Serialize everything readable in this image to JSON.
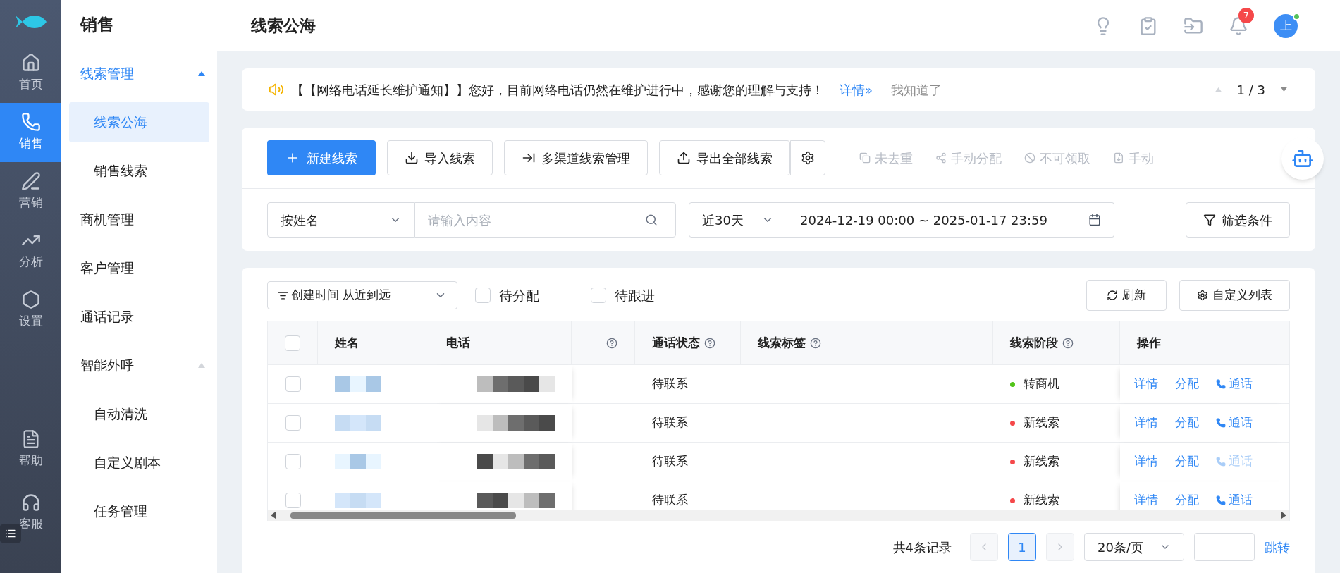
{
  "rail": {
    "items": [
      {
        "label": "首页",
        "selected": false
      },
      {
        "label": "销售",
        "selected": true
      },
      {
        "label": "营销",
        "selected": false
      },
      {
        "label": "分析",
        "selected": false
      },
      {
        "label": "设置",
        "selected": false
      }
    ],
    "bottom_items": [
      {
        "label": "帮助"
      },
      {
        "label": "客服"
      }
    ]
  },
  "sidebar": {
    "title": "销售",
    "items": [
      {
        "label": "线索管理",
        "expanded": true,
        "children": [
          {
            "label": "线索公海",
            "selected": true
          },
          {
            "label": "销售线索",
            "selected": false
          }
        ]
      },
      {
        "label": "商机管理"
      },
      {
        "label": "客户管理"
      },
      {
        "label": "通话记录"
      },
      {
        "label": "智能外呼",
        "expanded": true,
        "children": [
          {
            "label": "自动清洗",
            "selected": false
          },
          {
            "label": "自定义剧本",
            "selected": false
          },
          {
            "label": "任务管理",
            "selected": false
          }
        ]
      }
    ]
  },
  "header": {
    "title": "线索公海",
    "notifications": "7",
    "avatar": "上"
  },
  "notice": {
    "text": "【【网络电话延长维护通知】】您好，目前网络电话仍然在维护进行中，感谢您的理解与支持！",
    "link": "详情»",
    "dismiss": "我知道了",
    "pager": "1 / 3"
  },
  "toolbar": {
    "primary": "新建线索",
    "buttons": [
      {
        "label": "导入线索"
      },
      {
        "label": "多渠道线索管理"
      },
      {
        "label": "导出全部线索"
      }
    ],
    "actions": [
      {
        "label": "未去重"
      },
      {
        "label": "手动分配"
      },
      {
        "label": "不可领取"
      },
      {
        "label": "手动"
      }
    ]
  },
  "filters": {
    "field": "按姓名",
    "placeholder": "请输入内容",
    "range": "近30天",
    "dates": "2024-12-19 00:00 ~ 2025-01-17 23:59",
    "more": "筛选条件"
  },
  "list_bar": {
    "sort": "创建时间 从近到远",
    "checks": [
      {
        "label": "待分配",
        "checked": false
      },
      {
        "label": "待跟进",
        "checked": false
      }
    ],
    "refresh": "刷新",
    "customize": "自定义列表"
  },
  "table": {
    "select_all": {
      "checked": false
    },
    "columns": [
      {
        "label": "姓名",
        "help": false
      },
      {
        "label": "电话",
        "help": false
      },
      {
        "help": true
      },
      {
        "label": "通话状态",
        "help": true
      },
      {
        "label": "线索标签",
        "help": true
      },
      {
        "label": "线索阶段",
        "help": true
      },
      {
        "label": "操作",
        "help": false
      }
    ],
    "rows": [
      {
        "checked": false,
        "call_status": "待联系",
        "stage": "转商机",
        "color": "#52c41a",
        "actions": [
          {
            "label": "详情",
            "disabled": false
          },
          {
            "label": "分配",
            "disabled": false
          },
          {
            "label": "通话",
            "kind": "call",
            "disabled": false
          }
        ]
      },
      {
        "checked": false,
        "call_status": "待联系",
        "stage": "新线索",
        "color": "#f5484a",
        "actions": [
          {
            "label": "详情",
            "disabled": false
          },
          {
            "label": "分配",
            "disabled": false
          },
          {
            "label": "通话",
            "kind": "call",
            "disabled": false
          }
        ]
      },
      {
        "checked": false,
        "call_status": "待联系",
        "stage": "新线索",
        "color": "#f5484a",
        "actions": [
          {
            "label": "详情",
            "disabled": false
          },
          {
            "label": "分配",
            "disabled": false
          },
          {
            "label": "通话",
            "kind": "call",
            "disabled": true
          }
        ]
      },
      {
        "checked": false,
        "call_status": "待联系",
        "stage": "新线索",
        "color": "#f5484a",
        "actions": [
          {
            "label": "详情",
            "disabled": false
          },
          {
            "label": "分配",
            "disabled": false
          },
          {
            "label": "通话",
            "kind": "call",
            "disabled": false
          }
        ]
      }
    ]
  },
  "pagination": {
    "total": "共4条记录",
    "pages": [
      {
        "label": "1",
        "selected": true
      }
    ],
    "size": "20条/页",
    "jump": "跳转"
  }
}
